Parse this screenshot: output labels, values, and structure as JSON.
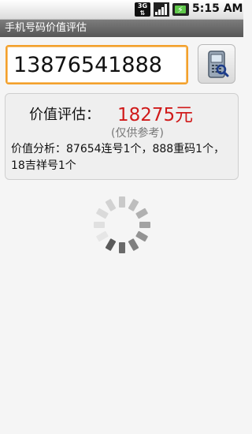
{
  "status_bar": {
    "network_badge": "3G",
    "time": "5:15 AM"
  },
  "app": {
    "title": "手机号码价值评估"
  },
  "search": {
    "phone_number": "13876541888",
    "lookup_icon": "phone-search-icon"
  },
  "result": {
    "value_label": "价值评估：",
    "value_amount": "18275元",
    "value_note": "(仅供参考)",
    "analysis": "价值分析：87654连号1个，888重码1个，18吉祥号1个"
  },
  "colors": {
    "accent_orange": "#f3a02b",
    "value_red": "#d01a1a",
    "title_bar": "#5f5f5f"
  }
}
